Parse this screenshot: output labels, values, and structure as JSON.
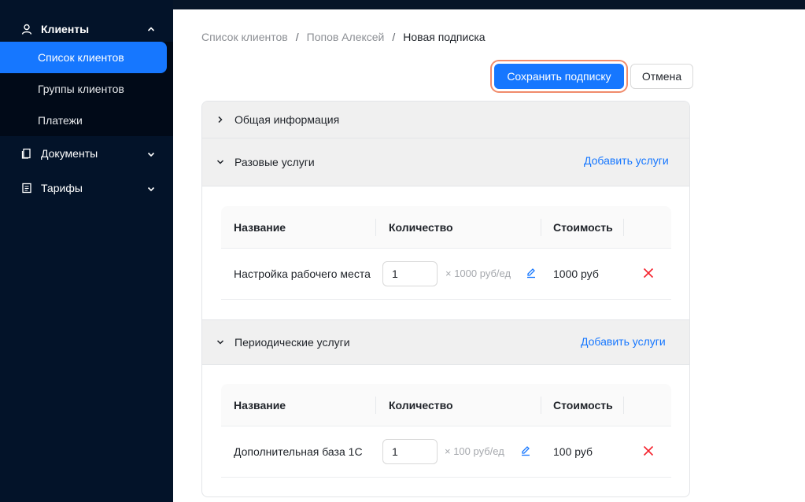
{
  "sidebar": {
    "clients": {
      "label": "Клиенты",
      "items": [
        "Список клиентов",
        "Группы клиентов",
        "Платежи"
      ]
    },
    "documents": "Документы",
    "tariffs": "Тарифы"
  },
  "breadcrumb": {
    "items": [
      "Список клиентов",
      "Попов Алексей"
    ],
    "separator": "/",
    "current": "Новая подписка"
  },
  "actions": {
    "save": "Сохранить подписку",
    "cancel": "Отмена"
  },
  "sections": {
    "general": "Общая информация",
    "one_time": {
      "title": "Разовые услуги",
      "add": "Добавить услуги",
      "columns": [
        "Название",
        "Количество",
        "Стоимость"
      ],
      "rows": [
        {
          "name": "Настройка рабочего места",
          "qty": "1",
          "price": "× 1000 руб/ед",
          "cost": "1000 руб"
        }
      ]
    },
    "periodic": {
      "title": "Периодические услуги",
      "add": "Добавить услуги",
      "columns": [
        "Название",
        "Количество",
        "Стоимость"
      ],
      "rows": [
        {
          "name": "Дополнительная база 1С",
          "qty": "1",
          "price": "× 100 руб/ед",
          "cost": "100 руб"
        }
      ]
    }
  },
  "colors": {
    "sidebar_bg": "#031329",
    "accent": "#1677ff",
    "delete": "#f5222d",
    "highlight": "#f08b6b"
  },
  "icons": [
    "user-icon",
    "chevron-up-icon",
    "document-icon",
    "tariff-icon",
    "chevron-down-icon",
    "chevron-right-icon",
    "edit-icon",
    "close-icon"
  ]
}
